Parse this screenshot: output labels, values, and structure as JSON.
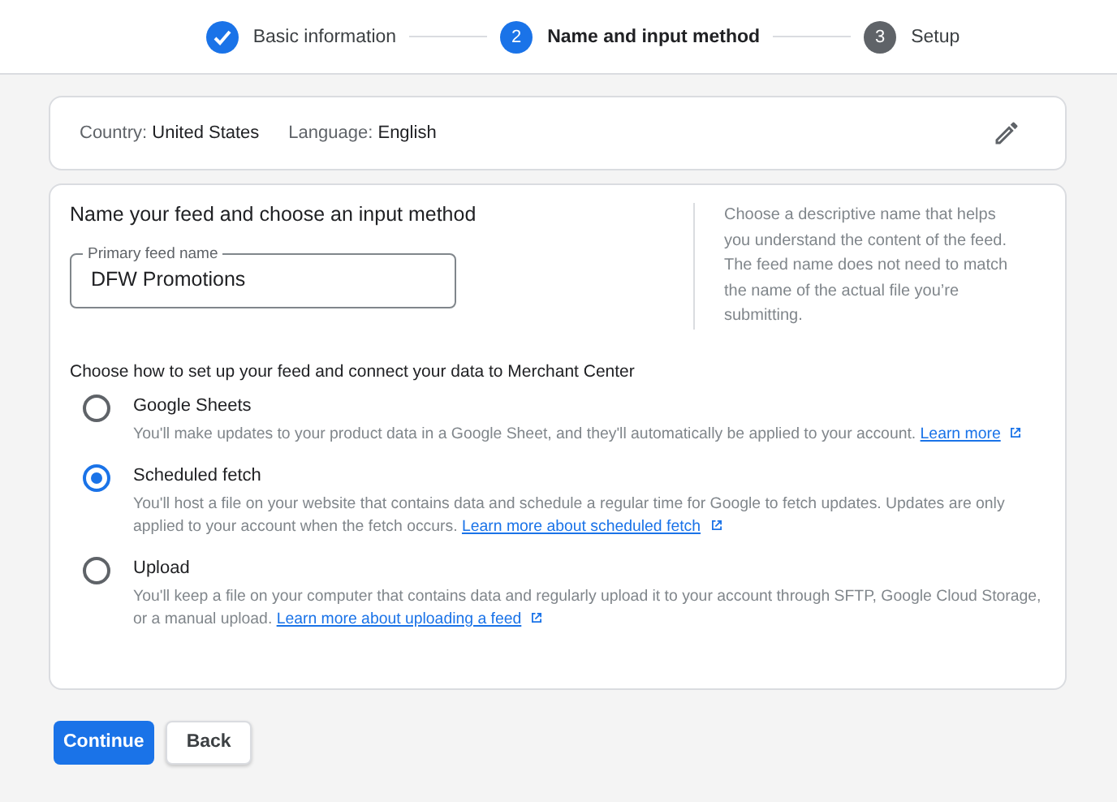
{
  "stepper": [
    {
      "label": "Basic information",
      "completed": true,
      "selected": false
    },
    {
      "number": "2",
      "label": "Name and input method",
      "completed": false,
      "selected": true
    },
    {
      "number": "3",
      "label": "Setup",
      "completed": false,
      "selected": false
    }
  ],
  "summary": {
    "items": [
      {
        "key": "Country:",
        "value": "United States"
      },
      {
        "key": "Language:",
        "value": "English"
      }
    ]
  },
  "form": {
    "title": "Name your feed and choose an input method",
    "feed_name": {
      "label": "Primary feed name",
      "value": "DFW Promotions"
    },
    "help": "Choose a descriptive name that helps you understand the content of the feed. The feed name does not need to match the name of the actual file you’re submitting.",
    "methods_title": "Choose how to set up your feed and connect your data to Merchant Center",
    "methods": [
      {
        "label": "Google Sheets",
        "selected": false,
        "description": "You'll make updates to your product data in a Google Sheet, and they'll automatically be applied to your account.",
        "link": "Learn more"
      },
      {
        "label": "Scheduled fetch",
        "selected": true,
        "description": "You'll host a file on your website that contains data and schedule a regular time for Google to fetch updates. Updates are only applied to your account when the fetch occurs.",
        "link": "Learn more about scheduled fetch"
      },
      {
        "label": "Upload",
        "selected": false,
        "description": "You'll keep a file on your computer that contains data and regularly upload it to your account through SFTP, Google Cloud Storage, or a manual upload.",
        "link": "Learn more about uploading a feed"
      }
    ]
  },
  "buttons": [
    {
      "label": "Continue",
      "kind": "primary"
    },
    {
      "label": "Back",
      "kind": "secondary"
    }
  ]
}
